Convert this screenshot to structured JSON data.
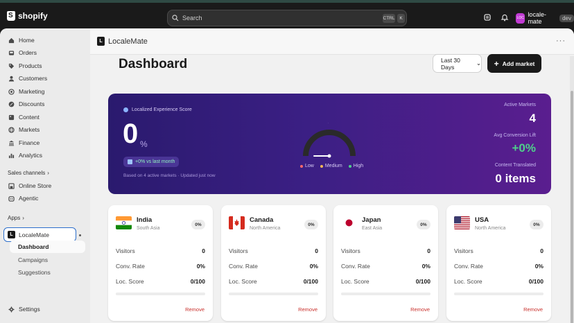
{
  "topbar": {
    "brand": "shopify",
    "search_placeholder": "Search",
    "shortcut_ctrl": "CTRL",
    "shortcut_key": "K",
    "store_name": "locale-mate",
    "store_badge": "dev",
    "avatar_initials": "LOC"
  },
  "sidebar": {
    "items": [
      {
        "label": "Home",
        "icon": "home-icon"
      },
      {
        "label": "Orders",
        "icon": "inbox-icon"
      },
      {
        "label": "Products",
        "icon": "tag-icon"
      },
      {
        "label": "Customers",
        "icon": "person-icon"
      },
      {
        "label": "Marketing",
        "icon": "target-icon"
      },
      {
        "label": "Discounts",
        "icon": "discount-icon"
      },
      {
        "label": "Content",
        "icon": "content-icon"
      },
      {
        "label": "Markets",
        "icon": "globe-icon"
      },
      {
        "label": "Finance",
        "icon": "bank-icon"
      },
      {
        "label": "Analytics",
        "icon": "chart-icon"
      }
    ],
    "sales_channels_label": "Sales channels",
    "sales_channels": [
      {
        "label": "Online Store",
        "icon": "store-icon"
      },
      {
        "label": "Agentic",
        "icon": "agent-icon"
      }
    ],
    "apps_label": "Apps",
    "app_name": "LocaleMate",
    "app_badge": "L",
    "app_subitems": [
      "Dashboard",
      "Campaigns",
      "Suggestions"
    ],
    "settings_label": "Settings"
  },
  "app_header": {
    "title": "LocaleMate",
    "badge": "L",
    "more": "···"
  },
  "page": {
    "title": "Dashboard",
    "range_select": "Last 30 Days",
    "add_market_label": "Add market"
  },
  "hero": {
    "label": "Localized Experience Score",
    "score": "0",
    "score_unit": "%",
    "trend": "+0% vs last month",
    "footnote": "Based on 4 active markets · Updated just now",
    "gauge_level": 0,
    "legend": [
      {
        "label": "Low",
        "color": "#ff6b6b"
      },
      {
        "label": "Medium",
        "color": "#f7b955"
      },
      {
        "label": "High",
        "color": "#4fd18b"
      }
    ],
    "stats": [
      {
        "label": "Active Markets",
        "value": "4",
        "color": "#ffffff"
      },
      {
        "label": "Avg Conversion Lift",
        "value": "+0%",
        "color": "#4fd18b"
      },
      {
        "label": "Content Translated",
        "value": "0 items",
        "color": "#ffffff"
      }
    ]
  },
  "markets": [
    {
      "name": "India",
      "region": "South Asia",
      "pct": "0%",
      "flag": "india-flag",
      "visitors": "0",
      "conv_rate": "0%",
      "loc_score": "0/100",
      "remove": "Remove"
    },
    {
      "name": "Canada",
      "region": "North America",
      "pct": "0%",
      "flag": "canada-flag",
      "visitors": "0",
      "conv_rate": "0%",
      "loc_score": "0/100",
      "remove": "Remove"
    },
    {
      "name": "Japan",
      "region": "East Asia",
      "pct": "0%",
      "flag": "japan-flag",
      "visitors": "0",
      "conv_rate": "0%",
      "loc_score": "0/100",
      "remove": "Remove"
    },
    {
      "name": "USA",
      "region": "North America",
      "pct": "0%",
      "flag": "usa-flag",
      "visitors": "0",
      "conv_rate": "0%",
      "loc_score": "0/100",
      "remove": "Remove"
    }
  ],
  "market_labels": {
    "visitors": "Visitors",
    "conv_rate": "Conv. Rate",
    "loc_score": "Loc. Score"
  }
}
